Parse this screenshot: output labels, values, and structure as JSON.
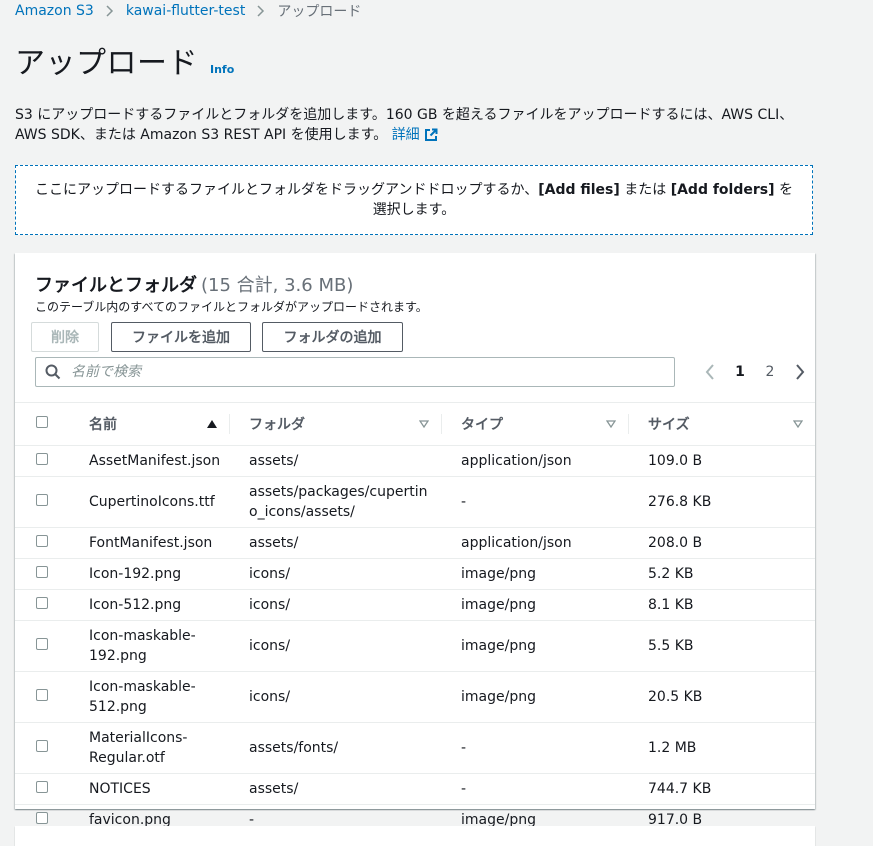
{
  "breadcrumb": {
    "items": [
      "Amazon S3",
      "kawai-flutter-test"
    ],
    "current": "アップロード"
  },
  "page": {
    "title": "アップロード",
    "info_label": "Info",
    "description": "S3 にアップロードするファイルとフォルダを追加します。160 GB を超えるファイルをアップロードするには、AWS CLI、AWS SDK、または Amazon S3 REST API を使用します。",
    "learn_more": "詳細"
  },
  "dropzone": {
    "text_before": "ここにアップロードするファイルとフォルダをドラッグアンドドロップするか、",
    "add_files": "[Add files]",
    "text_middle": " または ",
    "add_folders": "[Add folders]",
    "text_after": " を選択します。"
  },
  "files_panel": {
    "title": "ファイルとフォルダ",
    "count": "(15 合計, 3.6 MB)",
    "subtitle": "このテーブル内のすべてのファイルとフォルダがアップロードされます。",
    "delete_label": "削除",
    "add_files_label": "ファイルを追加",
    "add_folder_label": "フォルダの追加",
    "search_placeholder": "名前で検索",
    "pagination": {
      "pages": [
        "1",
        "2"
      ],
      "current": "1"
    },
    "columns": [
      "名前",
      "フォルダ",
      "タイプ",
      "サイズ"
    ],
    "rows": [
      {
        "name": "AssetManifest.json",
        "folder": "assets/",
        "type": "application/json",
        "size": "109.0 B"
      },
      {
        "name": "CupertinoIcons.ttf",
        "folder": "assets/packages/cupertino_icons/assets/",
        "type": "-",
        "size": "276.8 KB"
      },
      {
        "name": "FontManifest.json",
        "folder": "assets/",
        "type": "application/json",
        "size": "208.0 B"
      },
      {
        "name": "Icon-192.png",
        "folder": "icons/",
        "type": "image/png",
        "size": "5.2 KB"
      },
      {
        "name": "Icon-512.png",
        "folder": "icons/",
        "type": "image/png",
        "size": "8.1 KB"
      },
      {
        "name": "Icon-maskable-192.png",
        "folder": "icons/",
        "type": "image/png",
        "size": "5.5 KB"
      },
      {
        "name": "Icon-maskable-512.png",
        "folder": "icons/",
        "type": "image/png",
        "size": "20.5 KB"
      },
      {
        "name": "MaterialIcons-Regular.otf",
        "folder": "assets/fonts/",
        "type": "-",
        "size": "1.2 MB"
      },
      {
        "name": "NOTICES",
        "folder": "assets/",
        "type": "-",
        "size": "744.7 KB"
      },
      {
        "name": "favicon.png",
        "folder": "-",
        "type": "image/png",
        "size": "917.0 B"
      }
    ]
  }
}
